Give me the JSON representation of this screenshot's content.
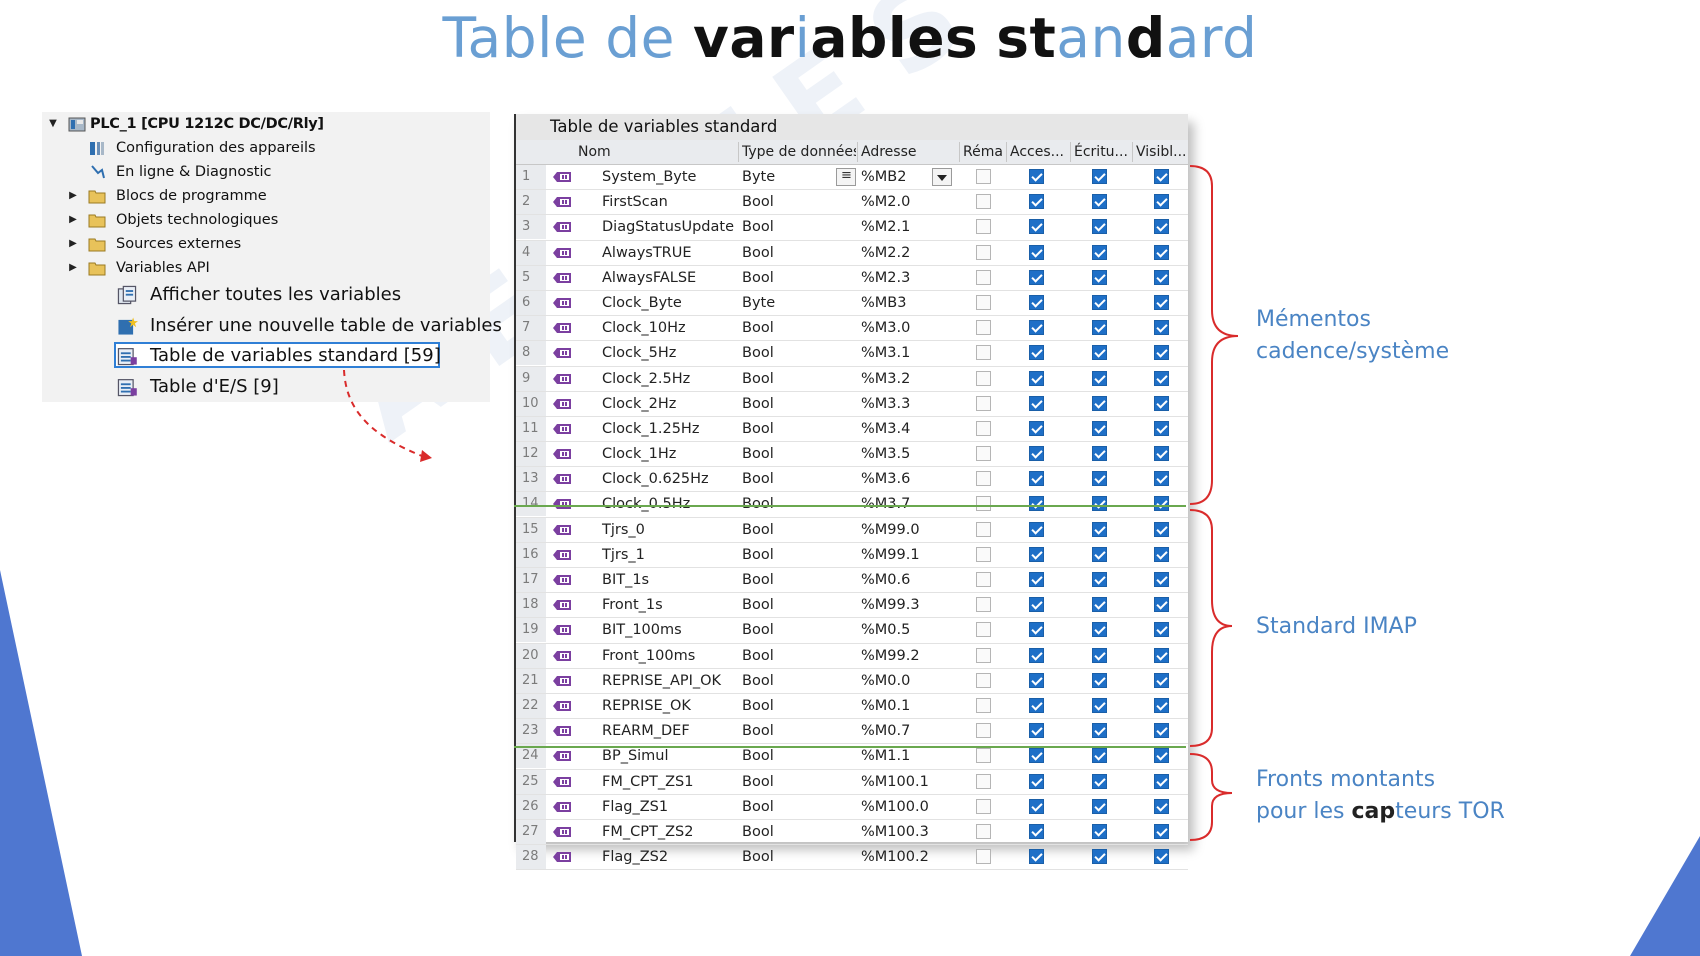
{
  "title": {
    "p1": "Table de ",
    "p2": "var",
    "p3": "i",
    "p4": "ables",
    "p5": " ",
    "p6": "st",
    "p7": "an",
    "p8": "d",
    "p9": "ard"
  },
  "tree": {
    "root": "PLC_1 [CPU 1212C DC/DC/Rly]",
    "items": [
      {
        "label": "Configuration des appareils",
        "icon": "device-config-icon",
        "arrow": false
      },
      {
        "label": "En ligne & Diagnostic",
        "icon": "online-diagnostic-icon",
        "arrow": false
      },
      {
        "label": "Blocs de programme",
        "icon": "folder-icon",
        "arrow": true
      },
      {
        "label": "Objets technologiques",
        "icon": "folder-icon",
        "arrow": true
      },
      {
        "label": "Sources externes",
        "icon": "folder-icon",
        "arrow": true
      },
      {
        "label": "Variables API",
        "icon": "folder-open-icon",
        "arrow": true
      }
    ],
    "sub": [
      {
        "label": "Afficher toutes les variables",
        "icon": "show-variables-icon"
      },
      {
        "label": "Insérer une nouvelle table de variables",
        "icon": "insert-table-icon"
      },
      {
        "label": "Table de variables standard [59]",
        "icon": "variable-table-icon",
        "selected": true
      },
      {
        "label": "Table d'E/S [9]",
        "icon": "variable-table-icon"
      }
    ]
  },
  "table": {
    "title": "Table de variables standard",
    "headers": {
      "name": "Nom",
      "type": "Type de données",
      "addr": "Adresse",
      "rema": "Réma",
      "acces": "Acces...",
      "ecritu": "Écritu...",
      "visibl": "Visibl..."
    },
    "rows": [
      {
        "n": "1",
        "name": "System_Byte",
        "type": "Byte",
        "addr": "%MB2"
      },
      {
        "n": "2",
        "name": "FirstScan",
        "type": "Bool",
        "addr": "%M2.0"
      },
      {
        "n": "3",
        "name": "DiagStatusUpdate",
        "type": "Bool",
        "addr": "%M2.1"
      },
      {
        "n": "4",
        "name": "AlwaysTRUE",
        "type": "Bool",
        "addr": "%M2.2"
      },
      {
        "n": "5",
        "name": "AlwaysFALSE",
        "type": "Bool",
        "addr": "%M2.3"
      },
      {
        "n": "6",
        "name": "Clock_Byte",
        "type": "Byte",
        "addr": "%MB3"
      },
      {
        "n": "7",
        "name": "Clock_10Hz",
        "type": "Bool",
        "addr": "%M3.0"
      },
      {
        "n": "8",
        "name": "Clock_5Hz",
        "type": "Bool",
        "addr": "%M3.1"
      },
      {
        "n": "9",
        "name": "Clock_2.5Hz",
        "type": "Bool",
        "addr": "%M3.2"
      },
      {
        "n": "10",
        "name": "Clock_2Hz",
        "type": "Bool",
        "addr": "%M3.3"
      },
      {
        "n": "11",
        "name": "Clock_1.25Hz",
        "type": "Bool",
        "addr": "%M3.4"
      },
      {
        "n": "12",
        "name": "Clock_1Hz",
        "type": "Bool",
        "addr": "%M3.5"
      },
      {
        "n": "13",
        "name": "Clock_0.625Hz",
        "type": "Bool",
        "addr": "%M3.6"
      },
      {
        "n": "14",
        "name": "Clock_0.5Hz",
        "type": "Bool",
        "addr": "%M3.7"
      },
      {
        "n": "15",
        "name": "Tjrs_0",
        "type": "Bool",
        "addr": "%M99.0"
      },
      {
        "n": "16",
        "name": "Tjrs_1",
        "type": "Bool",
        "addr": "%M99.1"
      },
      {
        "n": "17",
        "name": "BIT_1s",
        "type": "Bool",
        "addr": "%M0.6"
      },
      {
        "n": "18",
        "name": "Front_1s",
        "type": "Bool",
        "addr": "%M99.3"
      },
      {
        "n": "19",
        "name": "BIT_100ms",
        "type": "Bool",
        "addr": "%M0.5"
      },
      {
        "n": "20",
        "name": "Front_100ms",
        "type": "Bool",
        "addr": "%M99.2"
      },
      {
        "n": "21",
        "name": "REPRISE_API_OK",
        "type": "Bool",
        "addr": "%M0.0"
      },
      {
        "n": "22",
        "name": "REPRISE_OK",
        "type": "Bool",
        "addr": "%M0.1"
      },
      {
        "n": "23",
        "name": "REARM_DEF",
        "type": "Bool",
        "addr": "%M0.7"
      },
      {
        "n": "24",
        "name": "BP_Simul",
        "type": "Bool",
        "addr": "%M1.1"
      },
      {
        "n": "25",
        "name": "FM_CPT_ZS1",
        "type": "Bool",
        "addr": "%M100.1"
      },
      {
        "n": "26",
        "name": "Flag_ZS1",
        "type": "Bool",
        "addr": "%M100.0"
      },
      {
        "n": "27",
        "name": "FM_CPT_ZS2",
        "type": "Bool",
        "addr": "%M100.3"
      },
      {
        "n": "28",
        "name": "Flag_ZS2",
        "type": "Bool",
        "addr": "%M100.2"
      }
    ]
  },
  "annotations": {
    "a1_line1": "Mémentos",
    "a1_line2": "cadence/système",
    "a2": "Standard IMAP",
    "a3_line1": "Fronts montants",
    "a3_line2_p1": "pour les ",
    "a3_line2_p2": "cap",
    "a3_line2_p3": "teurs TOR"
  },
  "colors": {
    "accent": "#6a9fd3",
    "bracket": "#d92b2b",
    "group_line": "#6aa84f",
    "deco": "#4f77d0",
    "checkbox": "#1e6fc7"
  }
}
